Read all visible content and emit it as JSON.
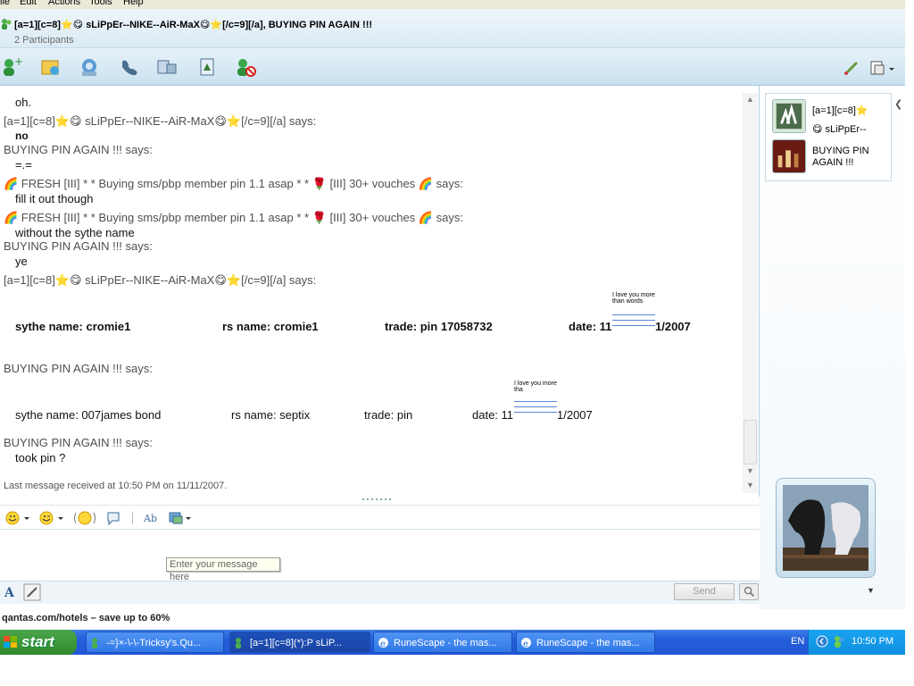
{
  "menu": [
    "ile",
    "Edit",
    "Actions",
    "Tools",
    "Help"
  ],
  "window": {
    "title": "[a=1][c=8]⭐😋 sLiPpEr--NIKE--AiR-MaX😋⭐[/c=9][/a], BUYING PIN AGAIN !!!",
    "participants": "2 Participants"
  },
  "conversation": {
    "lines": [
      {
        "kind": "msg",
        "text": "oh."
      },
      {
        "kind": "says",
        "text": "[a=1][c=8]⭐😋 sLiPpEr--NIKE--AiR-MaX😋⭐[/c=9][/a] says:"
      },
      {
        "kind": "msg",
        "text": "no"
      },
      {
        "kind": "says",
        "text": "BUYING PIN AGAIN !!! says:"
      },
      {
        "kind": "msg",
        "text": "=.="
      },
      {
        "kind": "says",
        "text": "🌈 FRESH [III] * * Buying sms/pbp member pin 1.1 asap * *  🌹 [III] 30+ vouches  🌈  says:"
      },
      {
        "kind": "msg",
        "text": "fill it out though"
      },
      {
        "kind": "says",
        "text": "🌈 FRESH [III] * * Buying sms/pbp member pin 1.1 asap * *  🌹 [III] 30+ vouches  🌈  says:"
      },
      {
        "kind": "msg",
        "text": "without the sythe name"
      },
      {
        "kind": "says",
        "text": "BUYING PIN AGAIN !!! says:"
      },
      {
        "kind": "msg",
        "text": "ye"
      },
      {
        "kind": "says",
        "text": "[a=1][c=8]⭐😋 sLiPpEr--NIKE--AiR-MaX😋⭐[/c=9][/a] says:"
      }
    ],
    "form1": {
      "sythe": "sythe name:  cromie1",
      "rs": "rs name:   cromie1",
      "trade": "trade: pin  17058732",
      "date_a": "date: 11",
      "date_b": "1/2007",
      "love": "I love you more than words"
    },
    "says_after_form1": "BUYING PIN AGAIN !!! says:",
    "form2": {
      "sythe": "sythe name:  007james bond",
      "rs": "rs name:   septix",
      "trade": "trade: pin",
      "date_a": "date: 11",
      "date_b": "1/2007",
      "love": "I love you more tha"
    },
    "says_last": "BUYING PIN AGAIN !!! says:",
    "last_msg": "took pin ?",
    "status": "Last message received at 10:50 PM on 11/11/2007."
  },
  "compose": {
    "placeholder": "Enter your message here",
    "send_label": "Send"
  },
  "sidebar": {
    "contact1_line1": "[a=1][c=8]⭐",
    "contact1_line2": "😋 sLiPpEr--",
    "contact2": "BUYING PIN AGAIN !!!"
  },
  "ad": "qantas.com/hotels – save up to 60%",
  "taskbar": {
    "start": "start",
    "tasks": [
      "-=}×-\\-\\-Tricksy's.Qu...",
      "[a=1][c=8](*):P sLiP...",
      "RuneScape - the mas...",
      "RuneScape - the mas..."
    ],
    "lang": "EN",
    "clock": "10:50 PM"
  }
}
